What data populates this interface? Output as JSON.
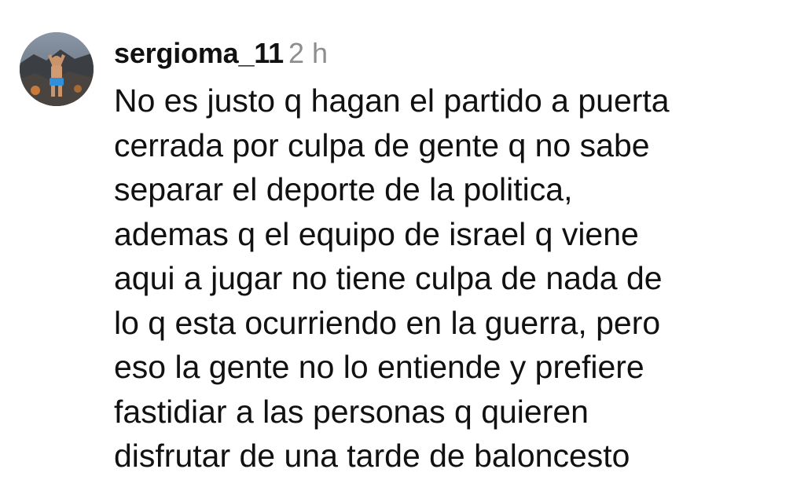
{
  "comment": {
    "avatar_icon": "user-avatar-photo",
    "username": "sergioma_11",
    "time_ago": "2 h",
    "lines": [
      "No es justo q hagan el partido a puerta",
      "cerrada por culpa de gente q no sabe",
      "separar el deporte de la politica,",
      "ademas q el equipo de israel q viene",
      "aqui a jugar no tiene culpa de nada de",
      "lo q esta ocurriendo en la guerra, pero",
      "eso la gente no lo entiende y prefiere",
      "fastidiar a las personas q quieren",
      "disfrutar de una tarde de baloncesto"
    ]
  },
  "colors": {
    "text": "#111111",
    "muted": "#8e8e8e",
    "background": "#ffffff"
  }
}
